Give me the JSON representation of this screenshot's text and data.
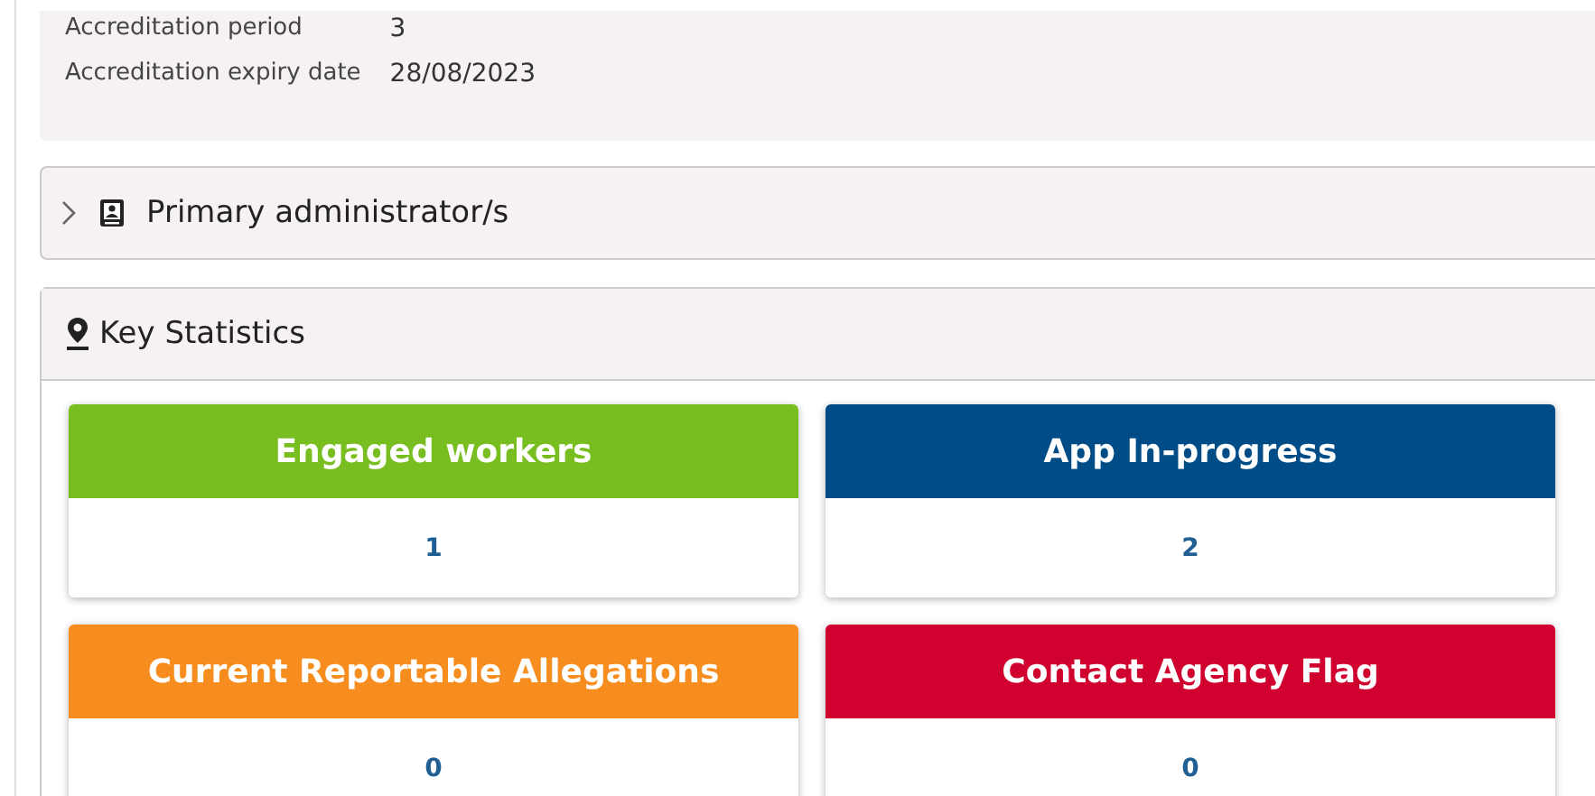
{
  "details": [
    {
      "label": "Accreditation period",
      "value": "3"
    },
    {
      "label": "Accreditation expiry date",
      "value": "28/08/2023"
    }
  ],
  "admin_section": {
    "title": "Primary administrator/s",
    "expanded": false
  },
  "key_statistics": {
    "title": "Key Statistics",
    "cards": [
      {
        "title": "Engaged workers",
        "value": "1",
        "color": "#78be20"
      },
      {
        "title": "App In-progress",
        "value": "2",
        "color": "#004c86"
      },
      {
        "title": "Current Reportable Allegations",
        "value": "0",
        "color": "#f68d1e"
      },
      {
        "title": "Contact Agency Flag",
        "value": "0",
        "color": "#d0002f"
      }
    ]
  }
}
